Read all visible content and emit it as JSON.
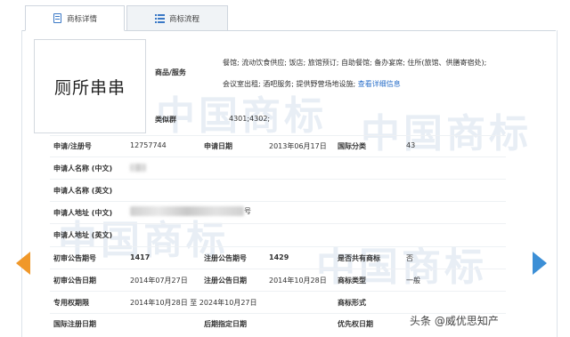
{
  "tabs": [
    {
      "label": "商标详情",
      "icon": "document-icon"
    },
    {
      "label": "商标流程",
      "icon": "list-icon"
    }
  ],
  "watermark": {
    "text": "中国商标"
  },
  "trademark": {
    "image_text": "厕所串串",
    "goods_services_label": "商品/服务",
    "goods_line1": "餐馆; 流动饮食供应; 饭店; 旅馆预订; 自助餐馆; 备办宴席; 住所(旅馆、供膳寄宿处);",
    "goods_line2": "会议室出租; 酒吧服务; 提供野营场地设施;",
    "goods_link": "查看详细信息",
    "similar_group_label": "类似群",
    "similar_group_value": "4301;4302;"
  },
  "fields": {
    "app_no_label": "申请/注册号",
    "app_no_value": "12757744",
    "app_date_label": "申请日期",
    "app_date_value": "2013年06月17日",
    "intl_class_label": "国际分类",
    "intl_class_value": "43",
    "applicant_cn_label": "申请人名称 (中文)",
    "applicant_en_label": "申请人名称 (英文)",
    "address_cn_label": "申请人地址 (中文)",
    "address_cn_suffix": "号",
    "address_en_label": "申请人地址 (英文)",
    "prelim_no_label": "初审公告期号",
    "prelim_no_value": "1417",
    "reg_no_label": "注册公告期号",
    "reg_no_value": "1429",
    "shared_label": "是否共有商标",
    "shared_value": "否",
    "prelim_date_label": "初审公告日期",
    "prelim_date_value": "2014年07月27日",
    "reg_date_label": "注册公告日期",
    "reg_date_value": "2014年10月28日",
    "type_label": "商标类型",
    "type_value": "一般",
    "exclusive_label": "专用权期限",
    "exclusive_value": "2014年10月28日 至 2024年10月27日",
    "form_label": "商标形式",
    "intl_reg_date_label": "国际注册日期",
    "later_date_label": "后期指定日期",
    "priority_date_label": "优先权日期"
  },
  "brand": {
    "text": "头条 @威优思知产"
  },
  "colors": {
    "accent": "#3a78c6",
    "left_arrow": "#f0982a",
    "right_arrow": "#3c8fd6",
    "link": "#2a6fc9"
  }
}
